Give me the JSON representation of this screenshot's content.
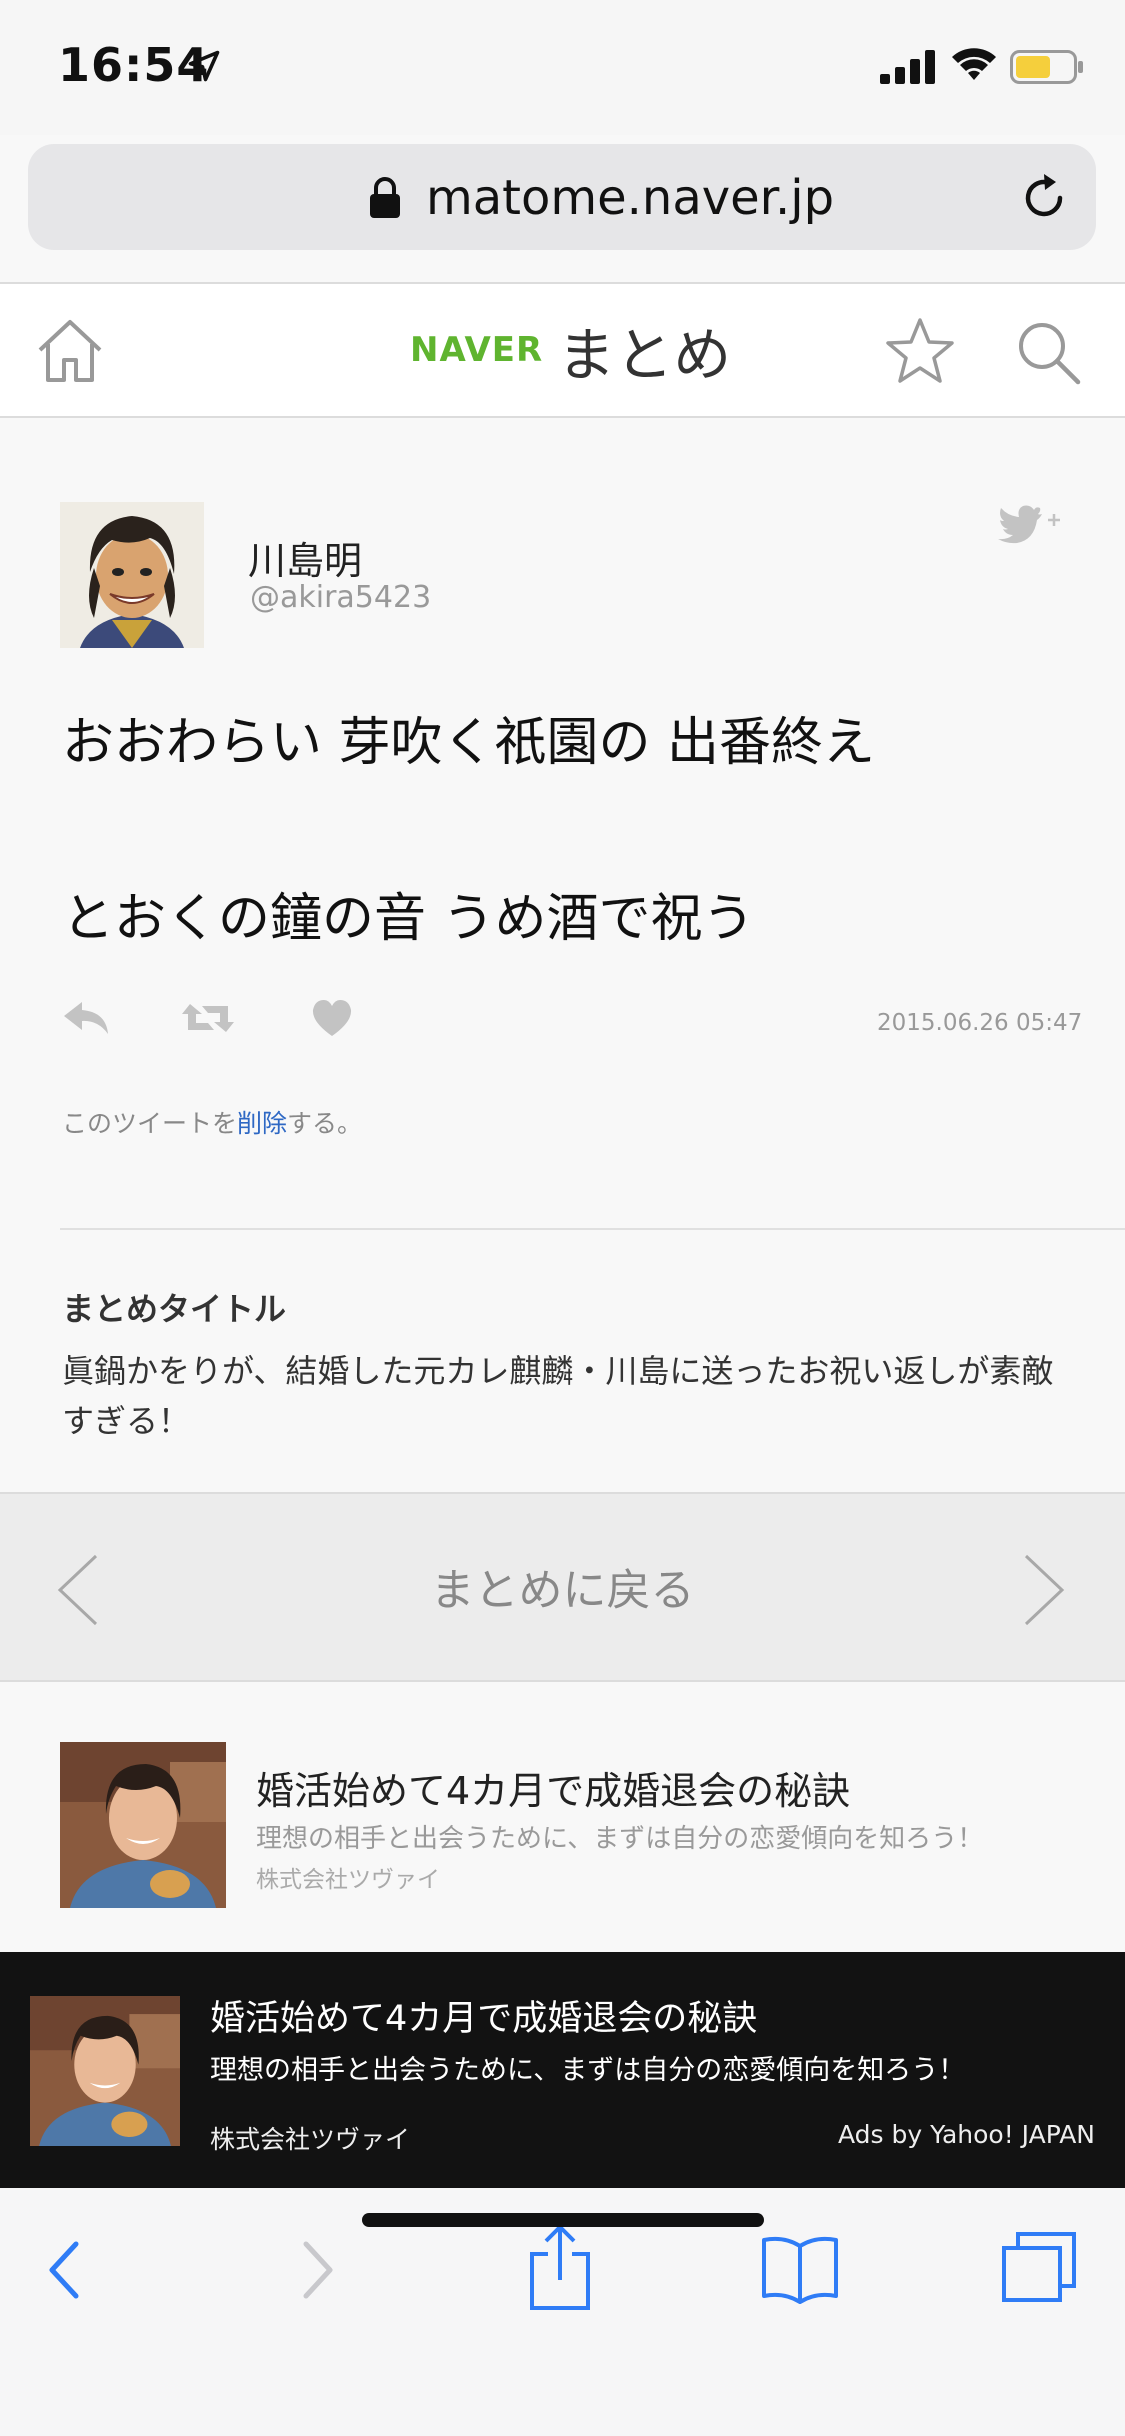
{
  "status_bar": {
    "time": "16:54"
  },
  "browser": {
    "url": "matome.naver.jp"
  },
  "site_header": {
    "logo_naver": "NAVER",
    "logo_matome": "まとめ"
  },
  "tweet": {
    "user_name": "川島明",
    "user_handle": "@akira5423",
    "line1": "おおわらい 芽吹く祇園の 出番終え",
    "line2": "とおくの鐘の音 うめ酒で祝う",
    "date": "2015.06.26 05:47",
    "delete_prefix": "このツイートを",
    "delete_link": "削除",
    "delete_suffix": "する。"
  },
  "matome_title": {
    "label": "まとめタイトル",
    "text": "眞鍋かをりが、結婚した元カレ麒麟・川島に送ったお祝い返しが素敵すぎる！"
  },
  "back_nav": {
    "label": "まとめに戻る"
  },
  "ad1": {
    "title": "婚活始めて4カ月で成婚退会の秘訣",
    "desc": "理想の相手と出会うために、まずは自分の恋愛傾向を知ろう！",
    "company": "株式会社ツヴァイ"
  },
  "ad2": {
    "title": "婚活始めて4カ月で成婚退会の秘訣",
    "desc": "理想の相手と出会うために、まずは自分の恋愛傾向を知ろう！",
    "company": "株式会社ツヴァイ",
    "ads_by": "Ads by Yahoo! JAPAN"
  },
  "colors": {
    "naver_green": "#5fb42f",
    "safari_blue": "#2f7cf6",
    "link_blue": "#2e68c4",
    "battery_yellow": "#f5cf3c"
  },
  "icons": [
    "location-arrow-icon",
    "signal-icon",
    "wifi-icon",
    "battery-icon",
    "lock-icon",
    "reload-icon",
    "home-icon",
    "star-icon",
    "search-icon",
    "twitter-follow-icon",
    "reply-icon",
    "retweet-icon",
    "like-icon",
    "chevron-left-icon",
    "chevron-right-icon",
    "share-icon",
    "bookmarks-icon",
    "tabs-icon"
  ]
}
